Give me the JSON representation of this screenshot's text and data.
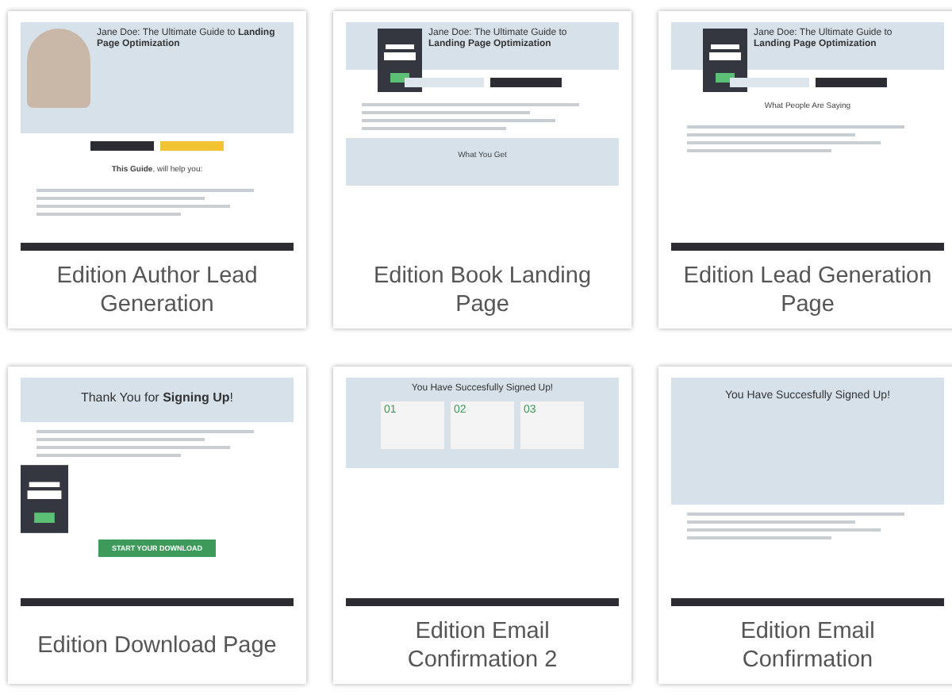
{
  "templates": [
    {
      "title": "Edition Author Lead Generation",
      "preview": {
        "kind": "author",
        "heading": "Jane Doe: The Ultimate Guide to **Landing Page Optimization**",
        "subheading": "**This Guide**, will help you:"
      }
    },
    {
      "title": "Edition Book Landing Page",
      "preview": {
        "kind": "book",
        "heading": "Jane Doe: The Ultimate Guide to **Landing Page Optimization**",
        "subheading": "What You Get"
      }
    },
    {
      "title": "Edition Lead Generation Page",
      "preview": {
        "kind": "lead",
        "heading": "Jane Doe: The Ultimate Guide to **Landing Page Optimization**",
        "subheading": "What People Are Saying"
      }
    },
    {
      "title": "Edition Download Page",
      "preview": {
        "kind": "download",
        "heading": "Thank You for **Signing Up**!",
        "button": "START YOUR DOWNLOAD"
      }
    },
    {
      "title": "Edition Email Confirmation 2",
      "preview": {
        "kind": "steps",
        "heading": "You Have Succesfully Signed Up!",
        "steps": [
          "01",
          "02",
          "03"
        ]
      }
    },
    {
      "title": "Edition Email Confirmation",
      "preview": {
        "kind": "confirm",
        "heading": "You Have Succesfully Signed Up!"
      }
    }
  ]
}
